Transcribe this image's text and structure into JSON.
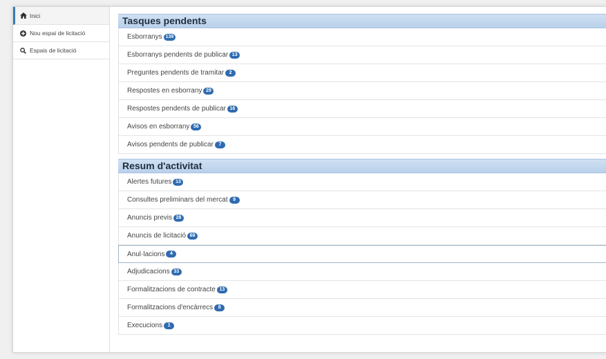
{
  "sidebar": {
    "items": [
      {
        "label": "Inici",
        "icon": "home-icon",
        "active": true
      },
      {
        "label": "Nou espai de licitació",
        "icon": "plus-circle-icon",
        "active": false
      },
      {
        "label": "Espais de licitació",
        "icon": "search-icon",
        "active": false
      }
    ]
  },
  "pending": {
    "title": "Tasques pendents",
    "rows": [
      {
        "label": "Esborranys",
        "count": "139"
      },
      {
        "label": "Esborranys pendents de publicar",
        "count": "13"
      },
      {
        "label": "Preguntes pendents de tramitar",
        "count": "2"
      },
      {
        "label": "Respostes en esborrany",
        "count": "29"
      },
      {
        "label": "Respostes pendents de publicar",
        "count": "16"
      },
      {
        "label": "Avisos en esborrany",
        "count": "56"
      },
      {
        "label": "Avisos pendents de publicar",
        "count": "7"
      }
    ]
  },
  "activity": {
    "title": "Resum d'activitat",
    "rows": [
      {
        "label": "Alertes futures",
        "count": "13"
      },
      {
        "label": "Consultes preliminars del mercat",
        "count": "9"
      },
      {
        "label": "Anuncis previs",
        "count": "28"
      },
      {
        "label": "Anuncis de licitació",
        "count": "69"
      },
      {
        "label": "Anul·lacions",
        "count": "4"
      },
      {
        "label": "Adjudicacions",
        "count": "33"
      },
      {
        "label": "Formalitzacions de contracte",
        "count": "13"
      },
      {
        "label": "Formalitzacions d'encàrrecs",
        "count": "8"
      },
      {
        "label": "Execucions",
        "count": "1"
      }
    ]
  },
  "colors": {
    "accent": "#2f6bb0",
    "header_bg": "#c4d8ee"
  }
}
